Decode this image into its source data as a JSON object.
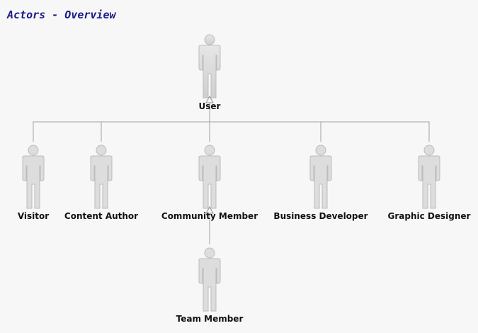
{
  "diagram": {
    "title": "Actors - Overview",
    "actors": {
      "user": "User",
      "visitor": "Visitor",
      "content_author": "Content Author",
      "community_member": "Community Member",
      "business_developer": "Business Developer",
      "graphic_designer": "Graphic Designer",
      "team_member": "Team Member"
    },
    "relationships": [
      {
        "from": "Visitor",
        "to": "User",
        "type": "generalization"
      },
      {
        "from": "Content Author",
        "to": "User",
        "type": "generalization"
      },
      {
        "from": "Community Member",
        "to": "User",
        "type": "generalization"
      },
      {
        "from": "Business Developer",
        "to": "User",
        "type": "generalization"
      },
      {
        "from": "Graphic Designer",
        "to": "User",
        "type": "generalization"
      },
      {
        "from": "Team Member",
        "to": "Community Member",
        "type": "generalization"
      }
    ]
  },
  "colors": {
    "background": "#f7f7f7",
    "title": "#1a1a8c",
    "actor_fill": "#dcdcdc",
    "actor_stroke": "#b8b8b8",
    "connector": "#a0a0a0"
  },
  "icons": {
    "actor": "person-figure-icon",
    "arrowhead": "hollow-triangle-arrow"
  }
}
